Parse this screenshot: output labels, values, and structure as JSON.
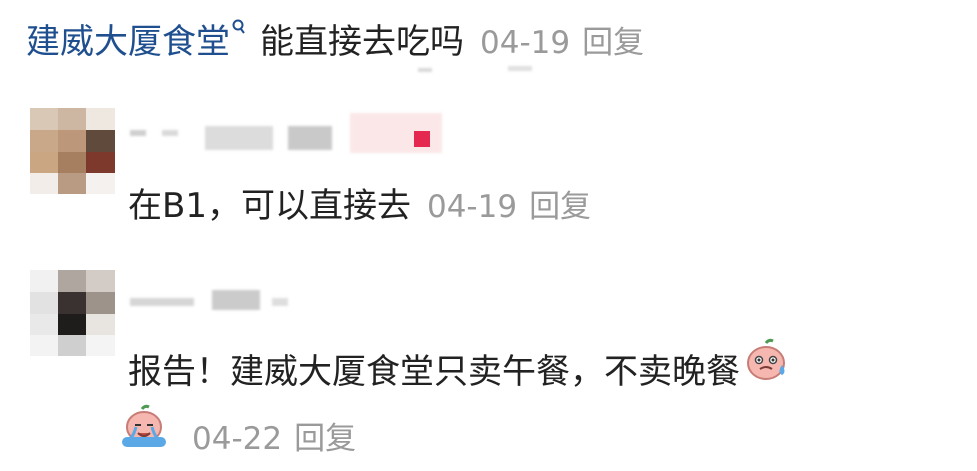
{
  "post": {
    "topic_link": "建威大厦食堂",
    "question": "能直接去吃吗",
    "date": "04-19",
    "reply_label": "回复"
  },
  "comments": [
    {
      "text": "在B1，可以直接去",
      "date": "04-19",
      "reply_label": "回复"
    },
    {
      "text": "报告！建威大厦食堂只卖午餐，不卖晚餐",
      "date": "04-22",
      "reply_label": "回复",
      "emojis": [
        "sweat-face-emoji",
        "crying-face-emoji"
      ]
    }
  ],
  "colors": {
    "link": "#1f4f8f",
    "meta": "#9a9a9a",
    "badge": "#e5284f"
  }
}
